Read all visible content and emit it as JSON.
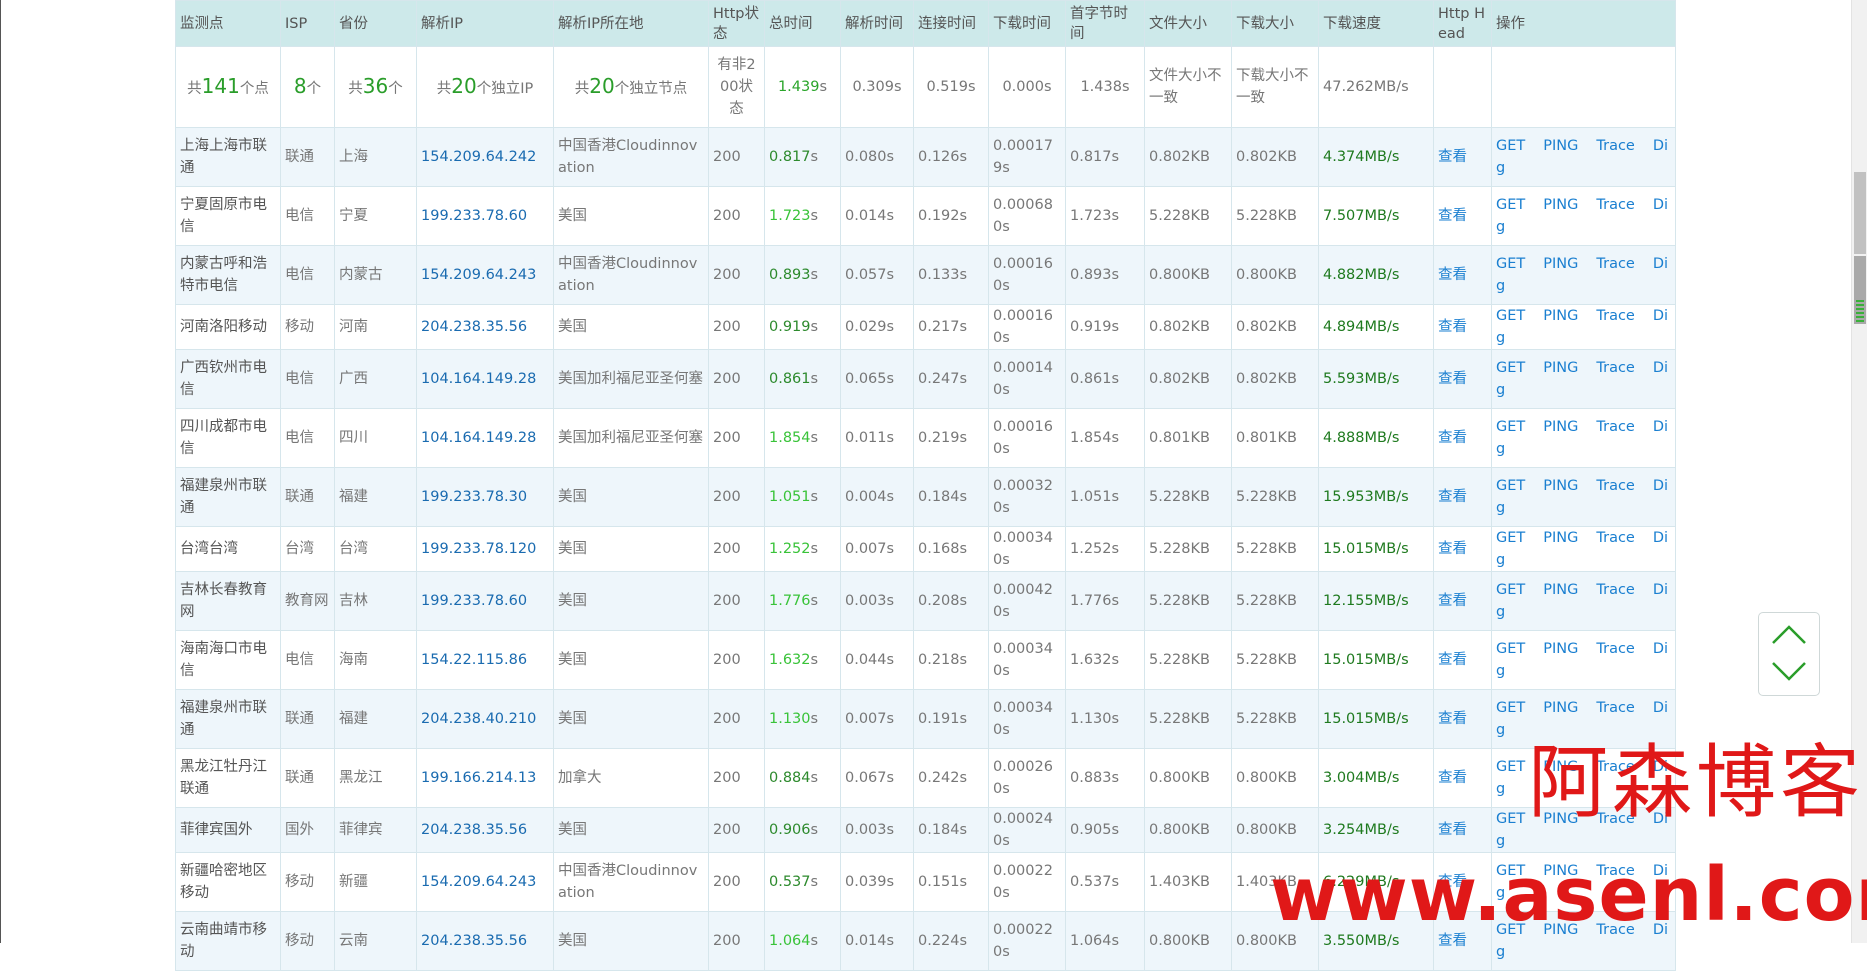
{
  "headers": {
    "station": "监测点",
    "isp": "ISP",
    "province": "省份",
    "ip": "解析IP",
    "ip_location": "解析IP所在地",
    "http_status": "Http状态",
    "total_time": "总时间",
    "resolve_time": "解析时间",
    "connect_time": "连接时间",
    "download_time": "下载时间",
    "first_byte_time": "首字节时间",
    "file_size": "文件大小",
    "download_size": "下载大小",
    "download_speed": "下载速度",
    "http_head": "Http Head",
    "operation": "操作"
  },
  "summary": {
    "points_prefix": "共",
    "points_count": "141",
    "points_suffix": "个点",
    "isp_count": "8",
    "isp_suffix": "个",
    "province_prefix": "共",
    "province_count": "36",
    "province_suffix": "个",
    "ip_prefix": "共",
    "ip_count": "20",
    "ip_suffix": "个独立IP",
    "node_prefix": "共",
    "node_count": "20",
    "node_suffix": "个独立节点",
    "status_text": "有非200状态",
    "total_time_value": "1.439",
    "total_time_unit": "s",
    "resolve_time": "0.309s",
    "connect_time": "0.519s",
    "download_time": "0.000s",
    "first_byte_time": "1.438s",
    "file_size": "文件大小不一致",
    "download_size": "下载大小不一致",
    "download_speed": "47.262MB/s"
  },
  "rows": [
    {
      "station": "上海上海市联通",
      "isp": "联通",
      "province": "上海",
      "ip": "154.209.64.242",
      "location": "中国香港Cloudinnovation",
      "status": "200",
      "total": "0.817",
      "resolve": "0.080s",
      "connect": "0.126s",
      "download": "0.000179s",
      "first_byte": "0.817s",
      "file_size": "0.802KB",
      "download_size": "0.802KB",
      "speed": "4.374MB/s"
    },
    {
      "station": "宁夏固原市电信",
      "isp": "电信",
      "province": "宁夏",
      "ip": "199.233.78.60",
      "location": "美国",
      "status": "200",
      "total": "1.723",
      "resolve": "0.014s",
      "connect": "0.192s",
      "download": "0.000680s",
      "first_byte": "1.723s",
      "file_size": "5.228KB",
      "download_size": "5.228KB",
      "speed": "7.507MB/s"
    },
    {
      "station": "内蒙古呼和浩特市电信",
      "isp": "电信",
      "province": "内蒙古",
      "ip": "154.209.64.243",
      "location": "中国香港Cloudinnovation",
      "status": "200",
      "total": "0.893",
      "resolve": "0.057s",
      "connect": "0.133s",
      "download": "0.000160s",
      "first_byte": "0.893s",
      "file_size": "0.800KB",
      "download_size": "0.800KB",
      "speed": "4.882MB/s"
    },
    {
      "station": "河南洛阳移动",
      "isp": "移动",
      "province": "河南",
      "ip": "204.238.35.56",
      "location": "美国",
      "status": "200",
      "total": "0.919",
      "resolve": "0.029s",
      "connect": "0.217s",
      "download": "0.000160s",
      "first_byte": "0.919s",
      "file_size": "0.802KB",
      "download_size": "0.802KB",
      "speed": "4.894MB/s"
    },
    {
      "station": "广西钦州市电信",
      "isp": "电信",
      "province": "广西",
      "ip": "104.164.149.28",
      "location": "美国加利福尼亚圣何塞",
      "status": "200",
      "total": "0.861",
      "resolve": "0.065s",
      "connect": "0.247s",
      "download": "0.000140s",
      "first_byte": "0.861s",
      "file_size": "0.802KB",
      "download_size": "0.802KB",
      "speed": "5.593MB/s"
    },
    {
      "station": "四川成都市电信",
      "isp": "电信",
      "province": "四川",
      "ip": "104.164.149.28",
      "location": "美国加利福尼亚圣何塞",
      "status": "200",
      "total": "1.854",
      "resolve": "0.011s",
      "connect": "0.219s",
      "download": "0.000160s",
      "first_byte": "1.854s",
      "file_size": "0.801KB",
      "download_size": "0.801KB",
      "speed": "4.888MB/s"
    },
    {
      "station": "福建泉州市联通",
      "isp": "联通",
      "province": "福建",
      "ip": "199.233.78.30",
      "location": "美国",
      "status": "200",
      "total": "1.051",
      "resolve": "0.004s",
      "connect": "0.184s",
      "download": "0.000320s",
      "first_byte": "1.051s",
      "file_size": "5.228KB",
      "download_size": "5.228KB",
      "speed": "15.953MB/s"
    },
    {
      "station": "台湾台湾",
      "isp": "台湾",
      "province": "台湾",
      "ip": "199.233.78.120",
      "location": "美国",
      "status": "200",
      "total": "1.252",
      "resolve": "0.007s",
      "connect": "0.168s",
      "download": "0.000340s",
      "first_byte": "1.252s",
      "file_size": "5.228KB",
      "download_size": "5.228KB",
      "speed": "15.015MB/s"
    },
    {
      "station": "吉林长春教育网",
      "isp": "教育网",
      "province": "吉林",
      "ip": "199.233.78.60",
      "location": "美国",
      "status": "200",
      "total": "1.776",
      "resolve": "0.003s",
      "connect": "0.208s",
      "download": "0.000420s",
      "first_byte": "1.776s",
      "file_size": "5.228KB",
      "download_size": "5.228KB",
      "speed": "12.155MB/s"
    },
    {
      "station": "海南海口市电信",
      "isp": "电信",
      "province": "海南",
      "ip": "154.22.115.86",
      "location": "美国",
      "status": "200",
      "total": "1.632",
      "resolve": "0.044s",
      "connect": "0.218s",
      "download": "0.000340s",
      "first_byte": "1.632s",
      "file_size": "5.228KB",
      "download_size": "5.228KB",
      "speed": "15.015MB/s"
    },
    {
      "station": "福建泉州市联通",
      "isp": "联通",
      "province": "福建",
      "ip": "204.238.40.210",
      "location": "美国",
      "status": "200",
      "total": "1.130",
      "resolve": "0.007s",
      "connect": "0.191s",
      "download": "0.000340s",
      "first_byte": "1.130s",
      "file_size": "5.228KB",
      "download_size": "5.228KB",
      "speed": "15.015MB/s"
    },
    {
      "station": "黑龙江牡丹江联通",
      "isp": "联通",
      "province": "黑龙江",
      "ip": "199.166.214.13",
      "location": "加拿大",
      "status": "200",
      "total": "0.884",
      "resolve": "0.067s",
      "connect": "0.242s",
      "download": "0.000260s",
      "first_byte": "0.883s",
      "file_size": "0.800KB",
      "download_size": "0.800KB",
      "speed": "3.004MB/s"
    },
    {
      "station": "菲律宾国外",
      "isp": "国外",
      "province": "菲律宾",
      "ip": "204.238.35.56",
      "location": "美国",
      "status": "200",
      "total": "0.906",
      "resolve": "0.003s",
      "connect": "0.184s",
      "download": "0.000240s",
      "first_byte": "0.905s",
      "file_size": "0.800KB",
      "download_size": "0.800KB",
      "speed": "3.254MB/s"
    },
    {
      "station": "新疆哈密地区移动",
      "isp": "移动",
      "province": "新疆",
      "ip": "154.209.64.243",
      "location": "中国香港Cloudinnovation",
      "status": "200",
      "total": "0.537",
      "resolve": "0.039s",
      "connect": "0.151s",
      "download": "0.000220s",
      "first_byte": "0.537s",
      "file_size": "1.403KB",
      "download_size": "1.403KB",
      "speed": "6.229MB/s"
    },
    {
      "station": "云南曲靖市移动",
      "isp": "移动",
      "province": "云南",
      "ip": "204.238.35.56",
      "location": "美国",
      "status": "200",
      "total": "1.064",
      "resolve": "0.014s",
      "connect": "0.224s",
      "download": "0.000220s",
      "first_byte": "1.064s",
      "file_size": "0.800KB",
      "download_size": "0.800KB",
      "speed": "3.550MB/s"
    }
  ],
  "total_unit": "s",
  "actions": {
    "view": "查看",
    "get": "GET",
    "ping": "PING",
    "trace": "Trace",
    "dig": "Dig"
  },
  "watermark": {
    "cn": "阿森博客",
    "url": "www.asenl.com"
  },
  "icons": {
    "up": "chevron-up-icon",
    "down": "chevron-down-icon"
  },
  "colors": {
    "header_bg": "#cde9ea",
    "row_alt": "#eef6fb",
    "link": "#1a7fd0",
    "ip": "#1a6bb0",
    "speed": "#1f7a1f",
    "watermark": "#e01818"
  }
}
